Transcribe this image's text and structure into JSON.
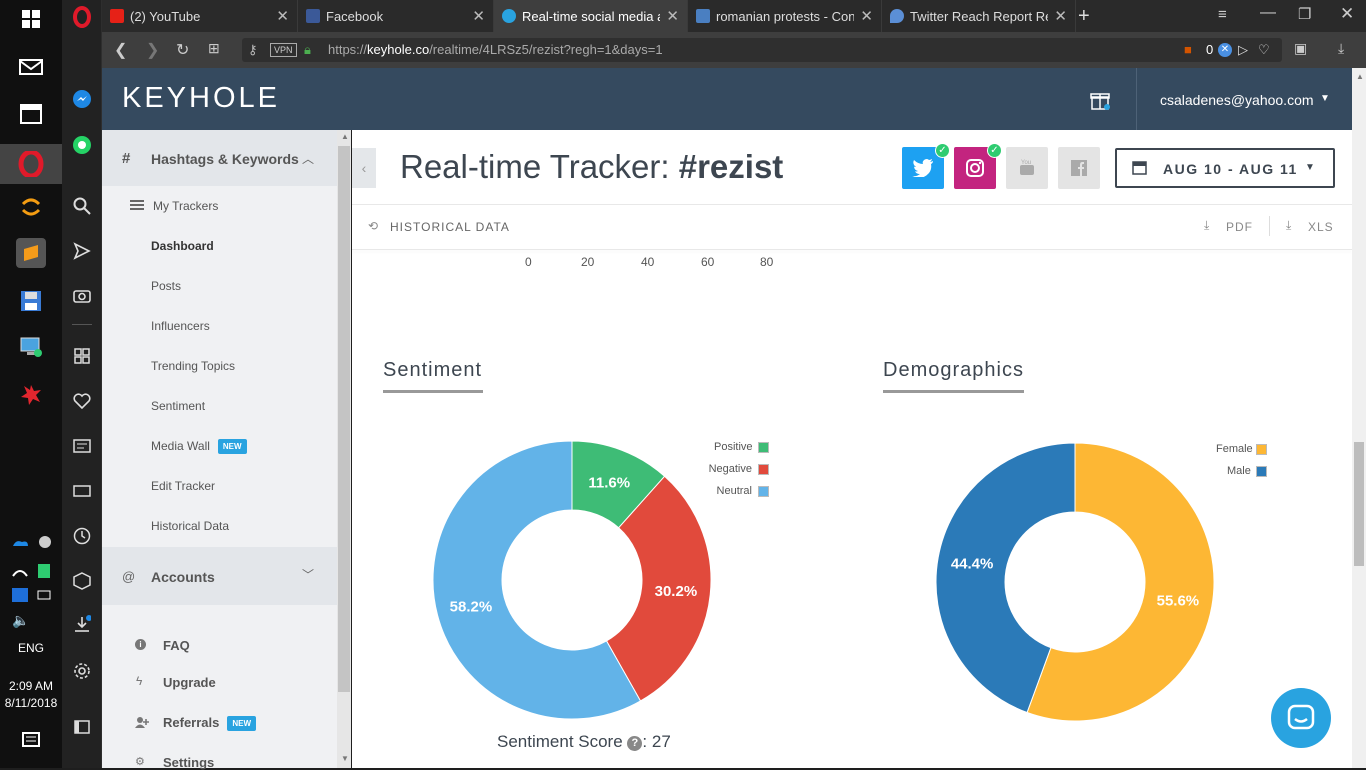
{
  "system": {
    "time": "2:09 AM",
    "date": "8/11/2018",
    "language": "ENG"
  },
  "browser": {
    "tabs": [
      {
        "title": "(2) YouTube"
      },
      {
        "title": "Facebook"
      },
      {
        "title": "Real-time social media ana"
      },
      {
        "title": "romanian protests - Conte"
      },
      {
        "title": "Twitter Reach Report Resul"
      }
    ],
    "url_prefix": "https://",
    "url_domain": "keyhole.co",
    "url_path": "/realtime/4LRSz5/rezist?regh=1&days=1",
    "vpn_label": "VPN",
    "block_count": "0"
  },
  "header": {
    "logo": "KEYHOLE",
    "user_email": "csaladenes@yahoo.com"
  },
  "sidebar": {
    "section_title": "Hashtags & Keywords",
    "section_icon": "#",
    "my_trackers": "My Trackers",
    "items": [
      {
        "label": "Dashboard",
        "active": true
      },
      {
        "label": "Posts"
      },
      {
        "label": "Influencers"
      },
      {
        "label": "Trending Topics"
      },
      {
        "label": "Sentiment"
      },
      {
        "label": "Media Wall",
        "badge": "NEW"
      },
      {
        "label": "Edit Tracker"
      },
      {
        "label": "Historical Data"
      }
    ],
    "accounts_icon": "@",
    "accounts": "Accounts",
    "bottom": [
      {
        "label": "FAQ",
        "icon": "info-icon"
      },
      {
        "label": "Upgrade",
        "icon": "lightning-icon"
      },
      {
        "label": "Referrals",
        "icon": "add-user-icon",
        "badge": "NEW"
      },
      {
        "label": "Settings",
        "icon": "gears-icon"
      }
    ]
  },
  "tracker": {
    "title_prefix": "Real-time Tracker: ",
    "hashtag": "#rezist",
    "date_range": "AUG 10 - AUG 11",
    "historical_label": "HISTORICAL DATA",
    "pdf_label": "PDF",
    "xls_label": "XLS",
    "axis_ticks": [
      "0",
      "20",
      "40",
      "60",
      "80"
    ]
  },
  "sentiment": {
    "title": "Sentiment",
    "score_label": "Sentiment Score",
    "score_value": ": 27"
  },
  "demographics": {
    "title": "Demographics"
  },
  "colors": {
    "positive": "#3ebc76",
    "negative": "#e14a3c",
    "neutral": "#62b3e8",
    "female": "#fdb734",
    "male": "#2b7ab8",
    "header_bg": "#354a5f"
  },
  "chart_data": [
    {
      "type": "pie",
      "title": "Sentiment",
      "categories": [
        "Positive",
        "Negative",
        "Neutral"
      ],
      "values": [
        11.6,
        30.2,
        58.2
      ],
      "labels": [
        "11.6%",
        "30.2%",
        "58.2%"
      ],
      "legend": "top-right"
    },
    {
      "type": "pie",
      "title": "Demographics",
      "categories": [
        "Female",
        "Male"
      ],
      "values": [
        55.6,
        44.4
      ],
      "labels": [
        "55.6%",
        "44.4%"
      ],
      "legend": "top-right"
    }
  ]
}
